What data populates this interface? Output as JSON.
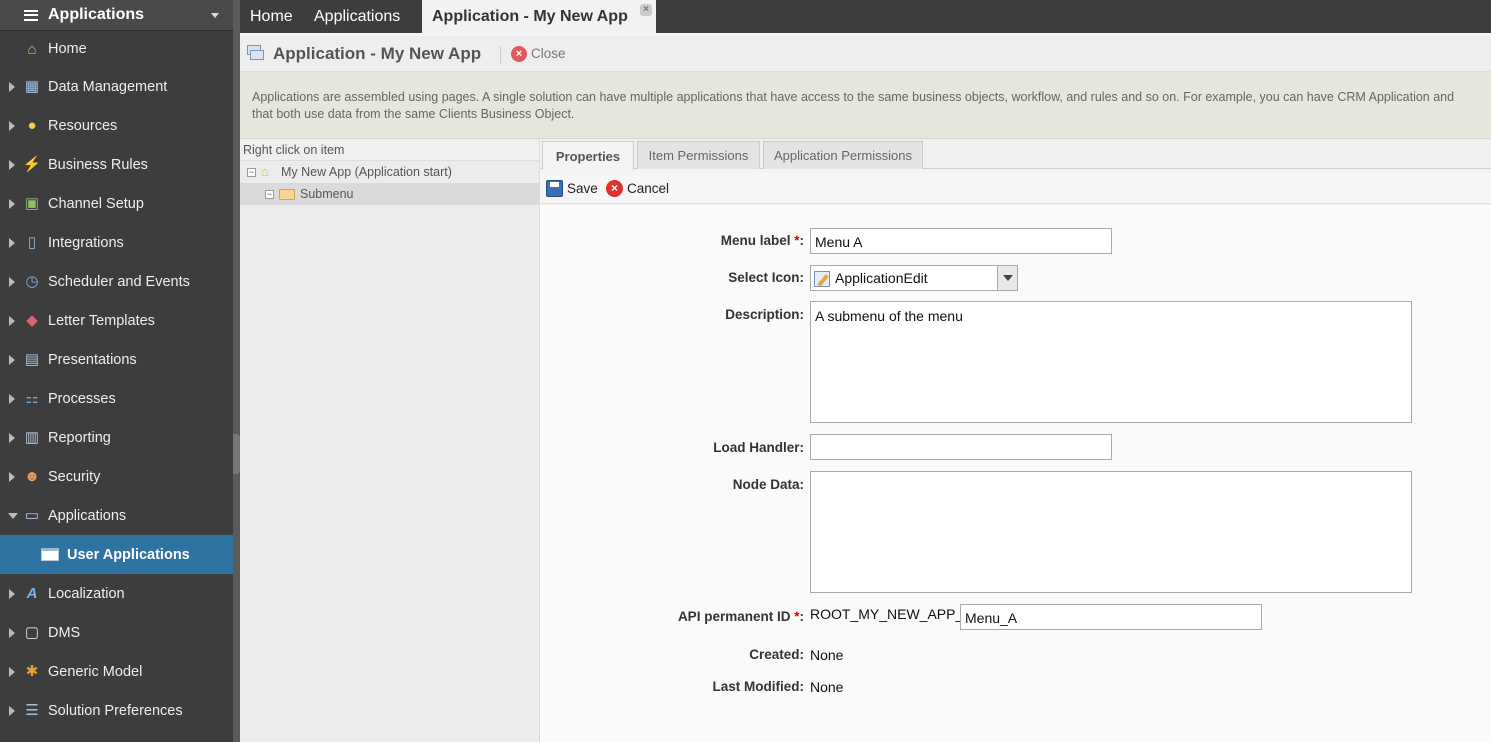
{
  "sidebar": {
    "header": "Applications",
    "items": [
      {
        "label": "Home",
        "icon": "home-icon",
        "glyph": "⌂"
      },
      {
        "label": "Data Management",
        "icon": "data-management-icon",
        "glyph": "▦"
      },
      {
        "label": "Resources",
        "icon": "lightbulb-icon",
        "glyph": "●"
      },
      {
        "label": "Business Rules",
        "icon": "lightning-icon",
        "glyph": "⚡"
      },
      {
        "label": "Channel Setup",
        "icon": "channel-icon",
        "glyph": "▣"
      },
      {
        "label": "Integrations",
        "icon": "integrations-icon",
        "glyph": "▯"
      },
      {
        "label": "Scheduler and Events",
        "icon": "clock-icon",
        "glyph": "◷"
      },
      {
        "label": "Letter Templates",
        "icon": "letter-icon",
        "glyph": "◆"
      },
      {
        "label": "Presentations",
        "icon": "presentation-icon",
        "glyph": "▤"
      },
      {
        "label": "Processes",
        "icon": "processes-icon",
        "glyph": "⚏"
      },
      {
        "label": "Reporting",
        "icon": "report-icon",
        "glyph": "▥"
      },
      {
        "label": "Security",
        "icon": "user-icon",
        "glyph": "☻"
      },
      {
        "label": "Applications",
        "icon": "applications-icon",
        "glyph": "▭"
      },
      {
        "label": "User Applications",
        "icon": "window-icon"
      },
      {
        "label": "Localization",
        "icon": "localization-icon",
        "glyph": "A"
      },
      {
        "label": "DMS",
        "icon": "document-icon",
        "glyph": "▢"
      },
      {
        "label": "Generic Model",
        "icon": "asterisk-icon",
        "glyph": "✱"
      },
      {
        "label": "Solution Preferences",
        "icon": "preferences-icon",
        "glyph": "☰"
      }
    ]
  },
  "tabs": {
    "home": "Home",
    "applications": "Applications",
    "active": "Application - My New App"
  },
  "titlebar": {
    "title": "Application - My New App",
    "close": "Close"
  },
  "info": {
    "line1": "Applications are assembled using pages. A single solution can have multiple applications that have access to the same business objects, workflow, and rules and so on. For example, you can have CRM Application and",
    "line2": "that both use data from the same Clients Business Object."
  },
  "tree": {
    "header": "Right click on item",
    "root": "My New App (Application start)",
    "child": "Submenu"
  },
  "content_tabs": [
    "Properties",
    "Item Permissions",
    "Application Permissions"
  ],
  "toolbar": {
    "save": "Save",
    "cancel": "Cancel"
  },
  "form": {
    "menu_label": {
      "label": "Menu label",
      "value": "Menu A"
    },
    "select_icon": {
      "label": "Select Icon:",
      "value": "ApplicationEdit"
    },
    "description": {
      "label": "Description:",
      "value": "A submenu of the menu"
    },
    "load_handler": {
      "label": "Load Handler:",
      "value": ""
    },
    "node_data": {
      "label": "Node Data:",
      "value": ""
    },
    "api_id": {
      "label": "API permanent ID",
      "prefix": "ROOT_MY_NEW_APP_",
      "value": "Menu_A"
    },
    "created": {
      "label": "Created:",
      "value": "None"
    },
    "last_modified": {
      "label": "Last Modified:",
      "value": "None"
    }
  }
}
